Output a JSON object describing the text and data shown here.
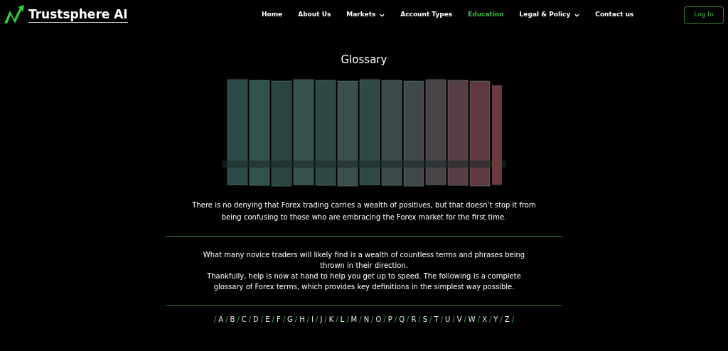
{
  "logo": {
    "text": "Trustsphere AI"
  },
  "nav": [
    {
      "label": "Home",
      "selected": false,
      "dropdown": false
    },
    {
      "label": "About Us",
      "selected": false,
      "dropdown": false
    },
    {
      "label": "Markets",
      "selected": false,
      "dropdown": true
    },
    {
      "label": "Account Types",
      "selected": false,
      "dropdown": false
    },
    {
      "label": "Education",
      "selected": true,
      "dropdown": false
    },
    {
      "label": "Legal & Policy",
      "selected": false,
      "dropdown": true
    },
    {
      "label": "Contact us",
      "selected": false,
      "dropdown": false
    }
  ],
  "login_button": "Log In",
  "title": "Glossary",
  "intro": "There is no denying that Forex trading carries a wealth of positives, but that doesn’t stop it from being confusing to those who are embracing the Forex market for the first time.",
  "paragraphs": [
    "What many novice traders will likely find is a wealth of countless terms and phrases being thrown in their direction.",
    "Thankfully, help is now at hand to help you get up to speed. The following is a complete glossary of Forex terms, which provides key definitions in the simplest way possible."
  ],
  "alphabet": {
    "letters": [
      {
        "separator": "/",
        "letter": "A"
      },
      {
        "separator": "/",
        "letter": "B"
      },
      {
        "separator": "/",
        "letter": "C"
      },
      {
        "separator": "/",
        "letter": "D"
      },
      {
        "separator": "/",
        "letter": "E"
      },
      {
        "separator": "/",
        "letter": "F"
      },
      {
        "separator": "/",
        "letter": "G"
      },
      {
        "separator": "/",
        "letter": "H"
      },
      {
        "separator": "/",
        "letter": "I"
      },
      {
        "separator": "/",
        "letter": "J"
      },
      {
        "separator": "/",
        "letter": "K"
      },
      {
        "separator": "/",
        "letter": "L"
      },
      {
        "separator": "/",
        "letter": "M"
      },
      {
        "separator": "/",
        "letter": "N"
      },
      {
        "separator": "/",
        "letter": "O"
      },
      {
        "separator": "/",
        "letter": "P"
      },
      {
        "separator": "/",
        "letter": "Q"
      },
      {
        "separator": "/",
        "letter": "R"
      },
      {
        "separator": "/",
        "letter": "S"
      },
      {
        "separator": "/",
        "letter": "T"
      },
      {
        "separator": "/",
        "letter": "U"
      },
      {
        "separator": "/",
        "letter": "V"
      },
      {
        "separator": "/",
        "letter": "W"
      },
      {
        "separator": "/",
        "letter": "X"
      },
      {
        "separator": "/",
        "letter": "Y"
      },
      {
        "separator": "/",
        "letter": "Z"
      }
    ],
    "trailing_separator": "/"
  }
}
